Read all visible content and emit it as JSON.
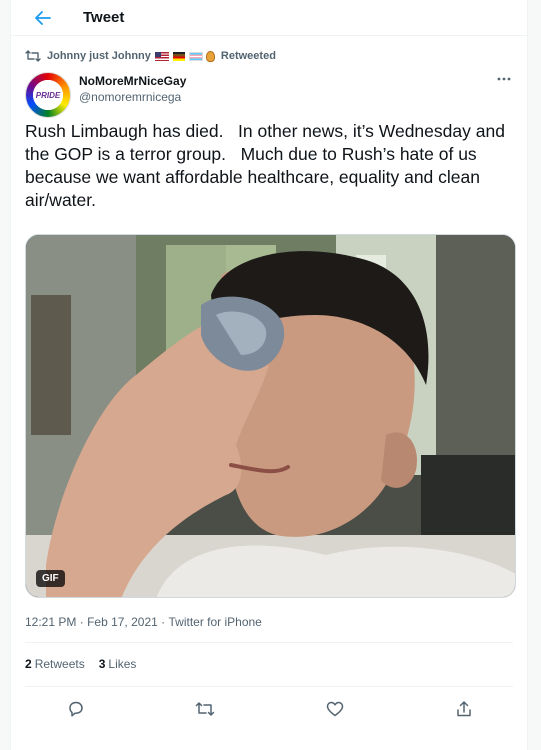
{
  "header": {
    "title": "Tweet"
  },
  "retweet": {
    "name": "Johnny just Johnny",
    "label": "Retweeted"
  },
  "author": {
    "display_name": "NoMoreMrNiceGay",
    "handle": "@nomoremrnicega",
    "avatar_text": "PRIDE"
  },
  "tweet": {
    "text": "Rush Limbaugh has died.   In other news, it’s Wednesday and the GOP is a terror group.   Much due to Rush’s hate of us because we want affordable healthcare, equality and clean air/water.",
    "media_badge": "GIF"
  },
  "meta": {
    "time": "12:21 PM",
    "separator": "·",
    "date": "Feb 17, 2021",
    "source": "Twitter for iPhone"
  },
  "stats": {
    "retweets_count": "2",
    "retweets_label": "Retweets",
    "likes_count": "3",
    "likes_label": "Likes"
  },
  "colors": {
    "accent": "#1d9bf0",
    "secondary_text": "#536471",
    "primary_text": "#0f1419"
  },
  "icons": [
    "back-arrow-icon",
    "retweet-icon",
    "more-icon",
    "reply-icon",
    "like-icon",
    "share-icon"
  ]
}
